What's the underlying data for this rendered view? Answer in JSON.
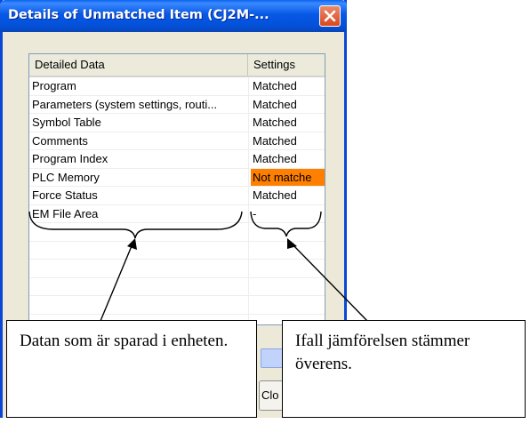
{
  "window": {
    "title": "Details of Unmatched Item (CJ2M-...",
    "close_glyph": "X"
  },
  "listview": {
    "columns": [
      "Detailed Data",
      "Settings"
    ],
    "rows": [
      {
        "item": "Program",
        "setting": "Matched",
        "status": "ok"
      },
      {
        "item": "Parameters (system settings, routi...",
        "setting": "Matched",
        "status": "ok"
      },
      {
        "item": "Symbol Table",
        "setting": "Matched",
        "status": "ok"
      },
      {
        "item": "Comments",
        "setting": "Matched",
        "status": "ok"
      },
      {
        "item": "Program Index",
        "setting": "Matched",
        "status": "ok"
      },
      {
        "item": "PLC Memory",
        "setting": "Not matche",
        "status": "bad"
      },
      {
        "item": "Force Status",
        "setting": "Matched",
        "status": "ok"
      },
      {
        "item": "EM File Area",
        "setting": "-",
        "status": "ok"
      }
    ],
    "highlight_color": "#ff8000"
  },
  "close_button": {
    "label": "Clo"
  },
  "annotations": {
    "left_text": "Datan som är sparad i enheten.",
    "right_text": "Ifall jämförelsen stämmer överens."
  }
}
